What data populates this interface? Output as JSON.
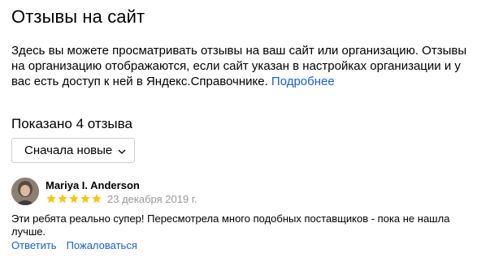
{
  "header": {
    "title": "Отзывы на сайт"
  },
  "intro": {
    "text": "Здесь вы можете просматривать отзывы на ваш сайт или организацию. Отзывы на организацию отображаются, если сайт указан в настройках организации и у вас есть доступ к ней в Яндекс.Справочнике.",
    "more_link": "Подробнее"
  },
  "reviews_summary": {
    "shown_label": "Показано 4 отзыва"
  },
  "sort": {
    "selected": "Сначала новые",
    "icon": "chevron-down-icon"
  },
  "reviews": [
    {
      "author": "Mariya I. Anderson",
      "rating": 5,
      "rating_max": 5,
      "date": "23 декабря 2019 г.",
      "text": "Эти ребята реально супер! Пересмотрела много подобных поставщиков - пока не нашла лучше.",
      "reply_label": "Ответить",
      "complain_label": "Пожаловаться"
    }
  ],
  "colors": {
    "link": "#1a5fd6",
    "star": "#f5c518",
    "muted": "#999999"
  }
}
